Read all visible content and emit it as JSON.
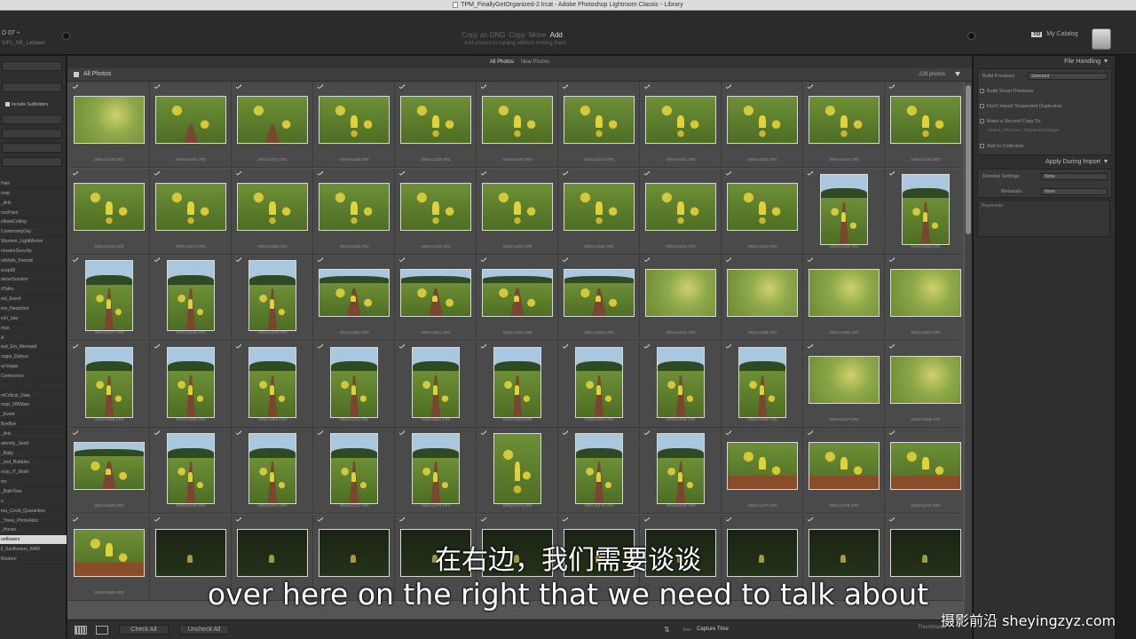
{
  "window": {
    "title": "TPM_FinallyGetOrganized-2.lrcat - Adobe Photoshop Lightroom Classic - Library"
  },
  "top": {
    "source_name": "D 07 ÷",
    "source_sub": "S/FL_NE_Lebowe",
    "modes": [
      "Copy as DNG",
      "Copy",
      "Move",
      "Add"
    ],
    "active_mode_index": 3,
    "mode_desc": "Add photos to catalog without moving them",
    "to_label": "TO",
    "catalog_label": "My Catalog"
  },
  "left": {
    "include_subfolders": "Include Subfolders",
    "folders": [
      "Hain",
      "roop",
      "_Arts",
      "ncePoint",
      "elbowCutting",
      "CommunityDay",
      "Shortest_LightMotion",
      "novatorSecurity",
      "ndVeds_Friends",
      "scop98",
      "ancerSurvivor",
      "dTalks",
      "est_Event",
      "ree_Headshot",
      "ech_Iata",
      "mas",
      "A",
      "iest_Em_Mermaid",
      "oogie_Dubsur",
      "acVegas",
      "Conference",
      "",
      "mCritical_Data",
      "roop_VMWare",
      "_Event",
      "ByeBye",
      "_Arts",
      "aternity_Jantit",
      "_Baby",
      "_and_Bubbles",
      "roop_IT_Mold",
      "ms",
      "_BathTime",
      "o",
      "ma_Covid_Quarantine",
      "_Trees_PhotoAdot",
      "_House",
      "unflowers",
      "ll_Sunflowers_RAW",
      "Restore"
    ],
    "selected_folder_index": 37
  },
  "grid": {
    "filters": [
      "All Photos",
      "New Photos"
    ],
    "title": "All Photos",
    "count": "228 photos",
    "cells": [
      {
        "name": "GI91A1225.CR2",
        "o": "l",
        "s": "blur"
      },
      {
        "name": "GI91A1226.CR2",
        "o": "l",
        "s": "field"
      },
      {
        "name": "GI91A1227.CR2",
        "o": "l",
        "s": "field"
      },
      {
        "name": "GI91A1228.CR2",
        "o": "l",
        "s": "kid"
      },
      {
        "name": "GI91A1229.CR2",
        "o": "l",
        "s": "kid"
      },
      {
        "name": "GI91A1230.CR2",
        "o": "l",
        "s": "kid"
      },
      {
        "name": "GI91A1231.CR2",
        "o": "l",
        "s": "kid"
      },
      {
        "name": "GI91A1232.CR2",
        "o": "l",
        "s": "kid"
      },
      {
        "name": "GI91A1233.CR2",
        "o": "l",
        "s": "kid"
      },
      {
        "name": "GI91A1234.CR2",
        "o": "l",
        "s": "kid"
      },
      {
        "name": "GI91A1235.CR2",
        "o": "l",
        "s": "kid"
      },
      {
        "name": "GI91A1236.CR2",
        "o": "l",
        "s": "kid"
      },
      {
        "name": "GI91A1237.CR2",
        "o": "l",
        "s": "kid"
      },
      {
        "name": "GI91A1238.CR2",
        "o": "l",
        "s": "kid"
      },
      {
        "name": "GI91A1239.CR2",
        "o": "l",
        "s": "kid"
      },
      {
        "name": "GI91A1240.CR2",
        "o": "l",
        "s": "kid"
      },
      {
        "name": "GI91A1241.CR2",
        "o": "l",
        "s": "kid"
      },
      {
        "name": "GI91A1242.CR2",
        "o": "l",
        "s": "kid"
      },
      {
        "name": "GI91A1243.CR2",
        "o": "l",
        "s": "kid"
      },
      {
        "name": "GI91A1244.CR2",
        "o": "l",
        "s": "kid"
      },
      {
        "name": "GI91A1245.CR2",
        "o": "p",
        "s": "row"
      },
      {
        "name": "GI91A1246.CR2",
        "o": "p",
        "s": "row"
      },
      {
        "name": "GI91A1247.CR2",
        "o": "p",
        "s": "row"
      },
      {
        "name": "GI91A1248.CR2",
        "o": "p",
        "s": "row"
      },
      {
        "name": "GI91A1249.CR2",
        "o": "p",
        "s": "row"
      },
      {
        "name": "GI91A1250.CR2",
        "o": "l",
        "s": "row"
      },
      {
        "name": "GI91A1251.CR2",
        "o": "l",
        "s": "row"
      },
      {
        "name": "GI91A1252.CR2",
        "o": "l",
        "s": "row"
      },
      {
        "name": "GI91A1253.CR2",
        "o": "l",
        "s": "row"
      },
      {
        "name": "GI91A1254.CR2",
        "o": "l",
        "s": "blur"
      },
      {
        "name": "GI91A1255.CR2",
        "o": "l",
        "s": "blur"
      },
      {
        "name": "GI91A1256.CR2",
        "o": "l",
        "s": "blur"
      },
      {
        "name": "GI91A1257.CR2",
        "o": "l",
        "s": "blur"
      },
      {
        "name": "GI91A1258.CR2",
        "o": "p",
        "s": "row"
      },
      {
        "name": "GI91A1259.CR2",
        "o": "p",
        "s": "row"
      },
      {
        "name": "GI91A1260.CR2",
        "o": "p",
        "s": "row"
      },
      {
        "name": "GI91A1261.CR2",
        "o": "p",
        "s": "row"
      },
      {
        "name": "GI91A1262.CR2",
        "o": "p",
        "s": "row"
      },
      {
        "name": "GI91A1263.CR2",
        "o": "p",
        "s": "row"
      },
      {
        "name": "GI91A1264.CR2",
        "o": "p",
        "s": "row"
      },
      {
        "name": "GI91A1265.CR2",
        "o": "p",
        "s": "row"
      },
      {
        "name": "GI91A1266.CR2",
        "o": "p",
        "s": "row"
      },
      {
        "name": "GI91A1267.CR2",
        "o": "l",
        "s": "blur"
      },
      {
        "name": "GI91A1268.CR2",
        "o": "l",
        "s": "blur"
      },
      {
        "name": "GI91A1269.CR2",
        "o": "l",
        "s": "row"
      },
      {
        "name": "GI91A1270.CR2",
        "o": "p",
        "s": "row"
      },
      {
        "name": "GI91A1271.CR2",
        "o": "p",
        "s": "row"
      },
      {
        "name": "GI91A1272.CR2",
        "o": "p",
        "s": "row"
      },
      {
        "name": "GI91A1273.CR2",
        "o": "p",
        "s": "row"
      },
      {
        "name": "GI91A1274.CR2",
        "o": "p",
        "s": "kid"
      },
      {
        "name": "GI91A1275.CR2",
        "o": "p",
        "s": "row"
      },
      {
        "name": "GI91A1276.CR2",
        "o": "p",
        "s": "row"
      },
      {
        "name": "GI91A1277.CR2",
        "o": "l",
        "s": "dirt"
      },
      {
        "name": "GI91A1278.CR2",
        "o": "l",
        "s": "dirt"
      },
      {
        "name": "GI91A1279.CR2",
        "o": "l",
        "s": "dirt"
      },
      {
        "name": "GI91A1280.CR2",
        "o": "l",
        "s": "dirt"
      },
      {
        "name": "",
        "o": "l",
        "s": "dark"
      },
      {
        "name": "",
        "o": "l",
        "s": "dark"
      },
      {
        "name": "",
        "o": "l",
        "s": "dark"
      },
      {
        "name": "",
        "o": "l",
        "s": "dark"
      },
      {
        "name": "",
        "o": "l",
        "s": "dark"
      },
      {
        "name": "",
        "o": "l",
        "s": "dark"
      },
      {
        "name": "",
        "o": "l",
        "s": "dark"
      },
      {
        "name": "",
        "o": "l",
        "s": "dark"
      },
      {
        "name": "",
        "o": "l",
        "s": "dark"
      },
      {
        "name": "",
        "o": "l",
        "s": "dark"
      }
    ]
  },
  "toolbar": {
    "check_all": "Check All",
    "uncheck_all": "Uncheck All",
    "sort_label": "Sort:",
    "sort_value": "Capture Time",
    "thumbnails_label": "Thumbnails"
  },
  "right": {
    "file_handling": "File Handling",
    "build_previews_label": "Build Previews",
    "build_previews_value": "Standard",
    "build_smart_previews": "Build Smart Previews",
    "dont_import_duplicates": "Don't Import Suspected Duplicates",
    "make_second_copy": "Make a Second Copy To:",
    "second_copy_path": "/Users/.../Pictures/.../Download Backups",
    "add_to_collection": "Add to Collection",
    "apply_during_import": "Apply During Import",
    "develop_settings_label": "Develop Settings",
    "develop_settings_value": "None",
    "metadata_label": "Metadata",
    "metadata_value": "None",
    "keywords_label": "Keywords"
  },
  "overlay": {
    "subtitle_zh": "在右边，我们需要谈谈",
    "subtitle_en": "over here on the right that we need to talk about",
    "watermark": "摄影前沿 sheyingzyz.com"
  }
}
